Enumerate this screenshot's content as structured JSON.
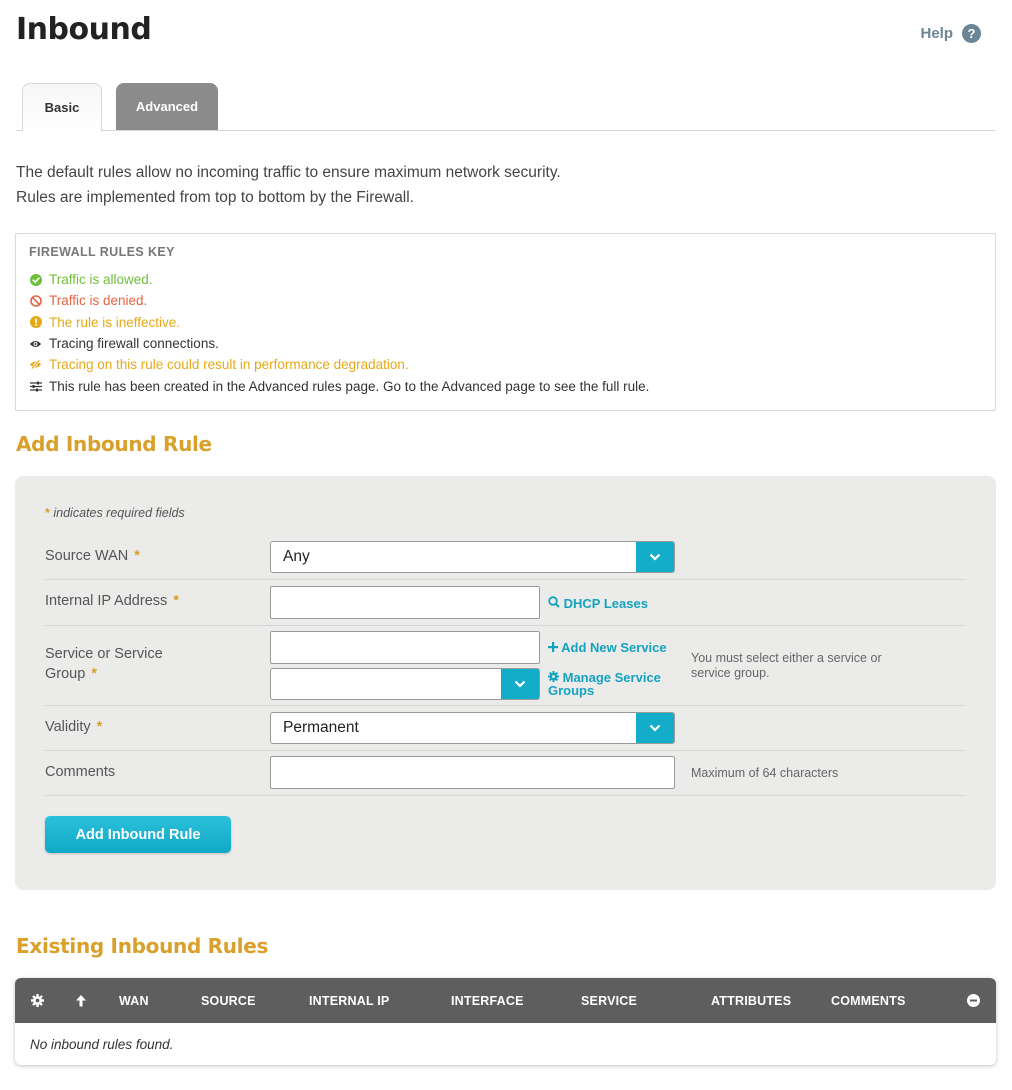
{
  "header": {
    "title": "Inbound",
    "help_label": "Help",
    "help_icon": "question-circle-icon"
  },
  "tabs": [
    {
      "label": "Basic",
      "active": true
    },
    {
      "label": "Advanced",
      "active": false
    }
  ],
  "intro": {
    "line1": "The default rules allow no incoming traffic to ensure maximum network security.",
    "line2": "Rules are implemented from top to bottom by the Firewall."
  },
  "rules_key": {
    "title": "FIREWALL RULES KEY",
    "items": [
      {
        "text": "Traffic is allowed.",
        "icon": "check-circle-icon",
        "color": "#6fbf3a"
      },
      {
        "text": "Traffic is denied.",
        "icon": "ban-icon",
        "color": "#e8633f"
      },
      {
        "text": "The rule is ineffective.",
        "icon": "exclamation-circle-icon",
        "color": "#e6a817"
      },
      {
        "text": "Tracing firewall connections.",
        "icon": "eye-icon",
        "color": "#333333"
      },
      {
        "text": "Tracing on this rule could result in performance degradation.",
        "icon": "eye-slash-icon",
        "color": "#e6a817"
      },
      {
        "text": "This rule has been created in the Advanced rules page. Go to the Advanced page to see the full rule.",
        "icon": "sliders-icon",
        "color": "#333333"
      }
    ]
  },
  "add_rule": {
    "title": "Add Inbound Rule",
    "required_note": "indicates required fields",
    "required_star": "*",
    "source_wan": {
      "label": "Source WAN",
      "value": "Any"
    },
    "internal_ip": {
      "label": "Internal IP Address",
      "value": "",
      "link": "DHCP Leases"
    },
    "service": {
      "label_line1": "Service or Service",
      "label_line2": "Group",
      "value": "",
      "group_value": "",
      "add_link": "Add New Service",
      "manage_link_line1": "Manage Service",
      "manage_link_line2": "Groups",
      "hint_line1": "You must select either a service or",
      "hint_line2": "service group."
    },
    "validity": {
      "label": "Validity",
      "value": "Permanent"
    },
    "comments": {
      "label": "Comments",
      "value": "",
      "hint": "Maximum of 64 characters"
    },
    "submit_label": "Add Inbound Rule"
  },
  "existing": {
    "title": "Existing Inbound Rules",
    "columns": [
      "WAN",
      "SOURCE",
      "INTERNAL IP",
      "INTERFACE",
      "SERVICE",
      "ATTRIBUTES",
      "COMMENTS"
    ],
    "empty_text": "No inbound rules found."
  },
  "colors": {
    "accent": "#14adc9",
    "heading": "#d9a02b",
    "table_header": "#5e5e5e",
    "tab_inactive": "#8b8b8b"
  }
}
